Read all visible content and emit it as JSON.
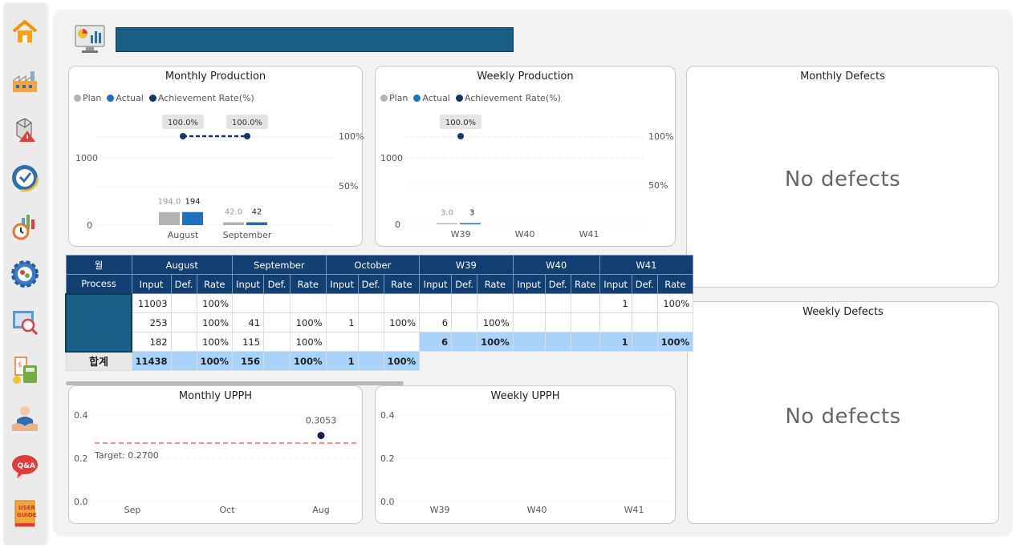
{
  "nav": {
    "items": [
      {
        "name": "home-icon"
      },
      {
        "name": "factory-icon"
      },
      {
        "name": "defect-alert-icon"
      },
      {
        "name": "kpi-icon"
      },
      {
        "name": "production-time-icon"
      },
      {
        "name": "settings-icon"
      },
      {
        "name": "inspection-map-icon"
      },
      {
        "name": "cost-calculator-icon"
      },
      {
        "name": "support-person-icon"
      },
      {
        "name": "qa-chat-icon",
        "label": "Q&A"
      },
      {
        "name": "user-guide-icon",
        "label": "USER GUIDE"
      }
    ]
  },
  "colors": {
    "plan": "#b3b3b3",
    "actual": "#1f6fc0",
    "rate": "#14376b",
    "header": "#0f3f73",
    "highlight": "#a8d4fb",
    "target": "#e88a8a"
  },
  "monthly_production": {
    "title": "Monthly Production",
    "legend": [
      "Plan",
      "Actual",
      "Achievement Rate(%)"
    ],
    "y_ticks": [
      "1000",
      "0"
    ],
    "y2_ticks": [
      "100%",
      "50%"
    ],
    "categories": [
      "August",
      "September"
    ],
    "plan": [
      194,
      42
    ],
    "actual": [
      194,
      42
    ],
    "plan_labels": [
      "194.0",
      "42.0"
    ],
    "actual_labels": [
      "194",
      "42"
    ],
    "rate_labels": [
      "100.0%",
      "100.0%"
    ],
    "rate": [
      100,
      100
    ]
  },
  "weekly_production": {
    "title": "Weekly Production",
    "legend": [
      "Plan",
      "Actual",
      "Achievement Rate(%)"
    ],
    "y_ticks": [
      "1000",
      "0"
    ],
    "y2_ticks": [
      "100%",
      "50%"
    ],
    "categories": [
      "W39",
      "W40",
      "W41"
    ],
    "plan": [
      3,
      null,
      null
    ],
    "actual": [
      3,
      null,
      null
    ],
    "plan_labels": [
      "3.0"
    ],
    "actual_labels": [
      "3"
    ],
    "rate_labels": [
      "100.0%"
    ],
    "rate": [
      100,
      null,
      null
    ]
  },
  "monthly_defects": {
    "title": "Monthly Defects",
    "message": "No defects"
  },
  "weekly_defects": {
    "title": "Weekly Defects",
    "message": "No defects"
  },
  "table": {
    "corner_label": "월",
    "process_label": "Process",
    "groups": [
      "August",
      "September",
      "October",
      "W39",
      "W40",
      "W41"
    ],
    "sub_headers": [
      "Input",
      "Def.",
      "Rate"
    ],
    "rows": [
      [
        "11003",
        "",
        "100%",
        "",
        "",
        "",
        "",
        "",
        "",
        "",
        "",
        "",
        "",
        "",
        "",
        "1",
        "",
        "100%"
      ],
      [
        "253",
        "",
        "100%",
        "41",
        "",
        "100%",
        "1",
        "",
        "100%",
        "6",
        "",
        "100%",
        "",
        "",
        "",
        "",
        "",
        ""
      ],
      [
        "182",
        "",
        "100%",
        "115",
        "",
        "100%",
        "",
        "",
        "",
        "6",
        "",
        "100%",
        "",
        "",
        "",
        "1",
        "",
        "100%"
      ]
    ],
    "total_label": "합계",
    "total": [
      "11438",
      "",
      "100%",
      "156",
      "",
      "100%",
      "1",
      "",
      "100%"
    ]
  },
  "monthly_upph": {
    "title": "Monthly UPPH",
    "y_ticks": [
      "0.4",
      "0.2",
      "0.0"
    ],
    "categories": [
      "Sep",
      "Oct",
      "Aug"
    ],
    "values": [
      null,
      null,
      0.3053
    ],
    "value_label": "0.3053",
    "target": 0.27,
    "target_label": "Target: 0.2700"
  },
  "weekly_upph": {
    "title": "Weekly UPPH",
    "y_ticks": [
      "0.4",
      "0.2",
      "0.0"
    ],
    "categories": [
      "W39",
      "W40",
      "W41"
    ]
  }
}
